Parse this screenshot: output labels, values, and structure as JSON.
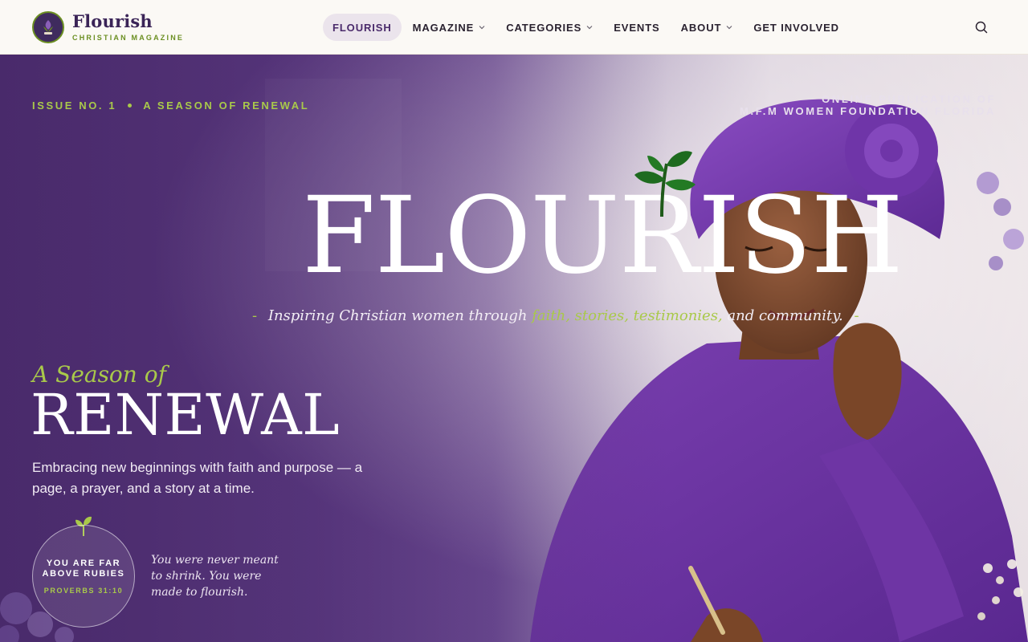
{
  "brand": {
    "name": "Flourish",
    "subtitle": "CHRISTIAN MAGAZINE",
    "logo_icon": "flourish-logo-icon"
  },
  "nav": {
    "items": [
      {
        "label": "FLOURISH",
        "active": true,
        "has_dropdown": false
      },
      {
        "label": "MAGAZINE",
        "active": false,
        "has_dropdown": true
      },
      {
        "label": "CATEGORIES",
        "active": false,
        "has_dropdown": true
      },
      {
        "label": "EVENTS",
        "active": false,
        "has_dropdown": false
      },
      {
        "label": "ABOUT",
        "active": false,
        "has_dropdown": true
      },
      {
        "label": "GET INVOLVED",
        "active": false,
        "has_dropdown": false
      }
    ],
    "search_icon": "search-icon"
  },
  "hero": {
    "issue_number": "ISSUE NO. 1",
    "issue_theme": "A SEASON OF RENEWAL",
    "publication_line1": "ONLINE PUBLICATION OF",
    "publication_line2": "M.F.M WOMEN FOUNDATION FLORIDA",
    "masthead": "FLOURISH",
    "tagline_prefix": "Inspiring Christian women through",
    "tagline_accent": "faith, stories, testimonies,",
    "tagline_suffix": "and community.",
    "tagline_dash": "-",
    "feature_kicker": "A Season of",
    "feature_title": "RENEWAL",
    "feature_body": "Embracing new beginnings with faith and purpose — a page, a prayer, and a story at a time.",
    "badge_title": "YOU ARE FAR ABOVE RUBIES",
    "badge_reference": "PROVERBS 31:10",
    "quote": "You were never meant to shrink. You were made to flourish."
  },
  "colors": {
    "brand_purple": "#3a2457",
    "accent_green": "#a9c94a",
    "hero_purple": "#5a3880",
    "header_bg": "#fbf9f5"
  }
}
